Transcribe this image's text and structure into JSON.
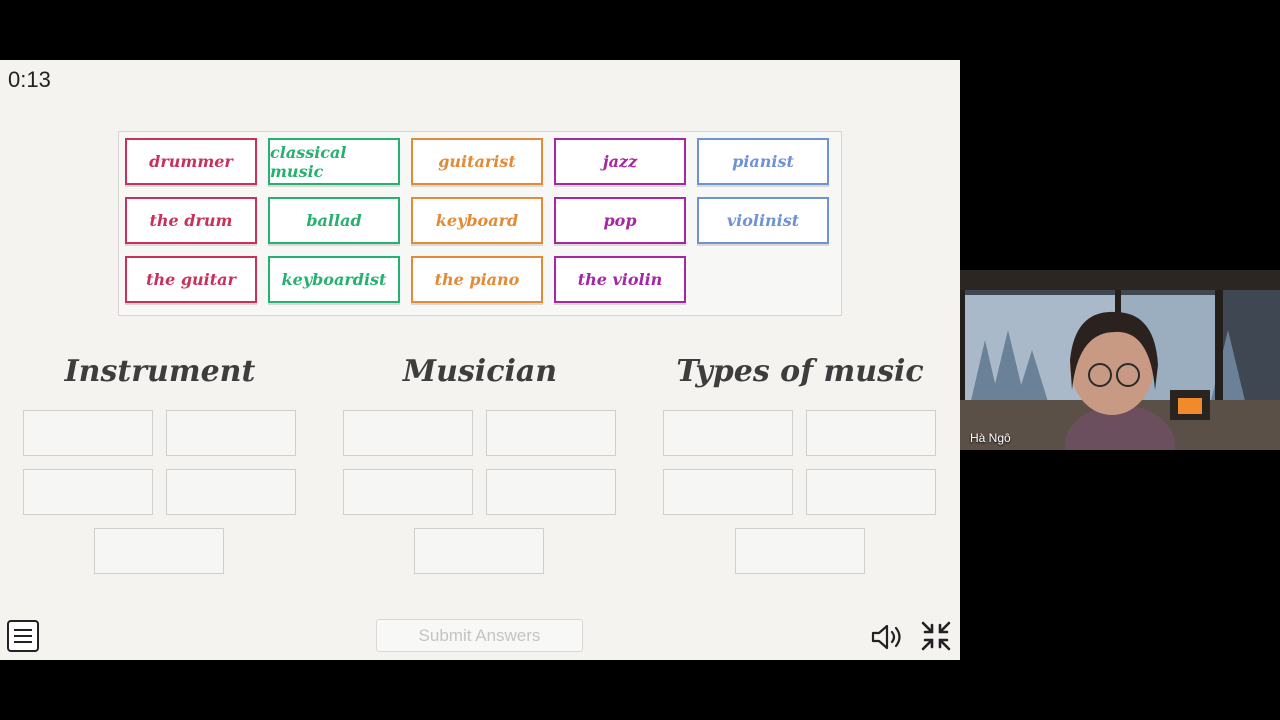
{
  "timer": "0:13",
  "word_bank": [
    {
      "text": "drummer",
      "color": "#c9305a"
    },
    {
      "text": "classical music",
      "color": "#27b06f"
    },
    {
      "text": "guitarist",
      "color": "#e28a35"
    },
    {
      "text": "jazz",
      "color": "#a626a4"
    },
    {
      "text": "pianist",
      "color": "#6f91d6"
    },
    {
      "text": "the drum",
      "color": "#c9305a"
    },
    {
      "text": "ballad",
      "color": "#27b06f"
    },
    {
      "text": "keyboard",
      "color": "#e28a35"
    },
    {
      "text": "pop",
      "color": "#a626a4"
    },
    {
      "text": "violinist",
      "color": "#6f91d6"
    },
    {
      "text": "the guitar",
      "color": "#c9305a"
    },
    {
      "text": "keyboardist",
      "color": "#27b06f"
    },
    {
      "text": "the piano",
      "color": "#e28a35"
    },
    {
      "text": "the violin",
      "color": "#a626a4"
    }
  ],
  "categories": [
    {
      "title": "Instrument"
    },
    {
      "title": "Musician"
    },
    {
      "title": "Types of music"
    }
  ],
  "submit_label": "Submit Answers",
  "video": {
    "participant_name": "Hà Ngô"
  },
  "icons": {
    "menu": "hamburger-menu-icon",
    "speaker": "speaker-icon",
    "collapse": "collapse-fullscreen-icon"
  }
}
